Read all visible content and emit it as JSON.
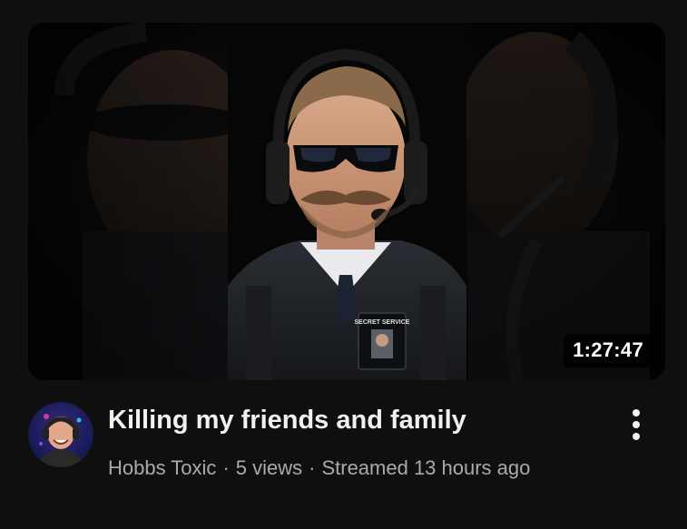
{
  "video": {
    "title": "Killing my friends and family",
    "duration": "1:27:47",
    "channel": "Hobbs Toxic",
    "separator": "·",
    "views": "5 views",
    "streamed": "Streamed 13 hours ago",
    "badge_text": "SECRET SERVICE"
  },
  "icons": {
    "more": "more-vertical-icon"
  },
  "colors": {
    "background": "#0f0f0f",
    "title": "#f1f1f1",
    "meta": "#aaaaaa",
    "duration_bg": "#000000"
  }
}
